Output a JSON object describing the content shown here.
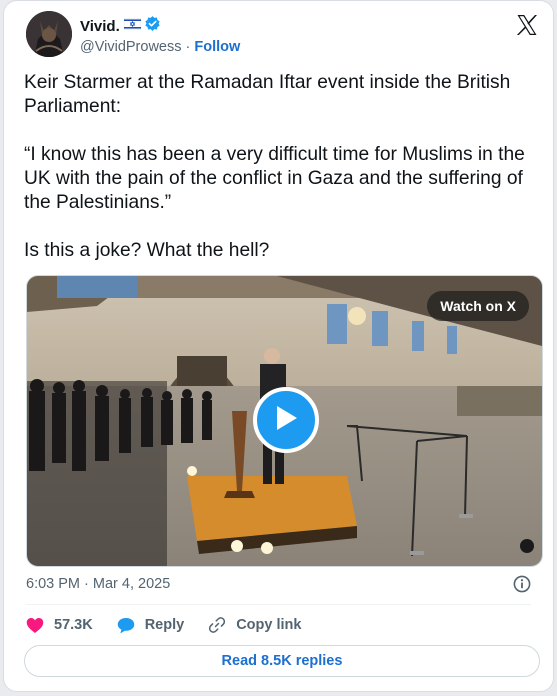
{
  "author": {
    "name": "Vivid.",
    "flag_icon": "israel-flag-icon",
    "verified_icon": "verified-badge-icon",
    "handle": "@VividProwess",
    "separator": "·",
    "follow_label": "Follow"
  },
  "platform_logo": "x-logo-icon",
  "tweet": {
    "line1": "Keir Starmer at the Ramadan Iftar event inside the British Parliament:",
    "line2": "“I know this has been a very difficult time for Muslims in the UK with the pain of the conflict in Gaza and the suffering of the Palestinians.”",
    "line3": "Is this a joke? What the hell?"
  },
  "media": {
    "watch_label": "Watch on X",
    "play_icon": "play-icon"
  },
  "meta": {
    "timestamp": "6:03 PM · Mar 4, 2025",
    "info_icon": "info-icon"
  },
  "actions": {
    "likes": "57.3K",
    "reply_label": "Reply",
    "copy_label": "Copy link"
  },
  "read_replies_label": "Read 8.5K replies",
  "colors": {
    "accent": "#1d9bf0",
    "link": "#1d6fd0",
    "like": "#f91880",
    "muted": "#536471",
    "text": "#0f1419"
  }
}
